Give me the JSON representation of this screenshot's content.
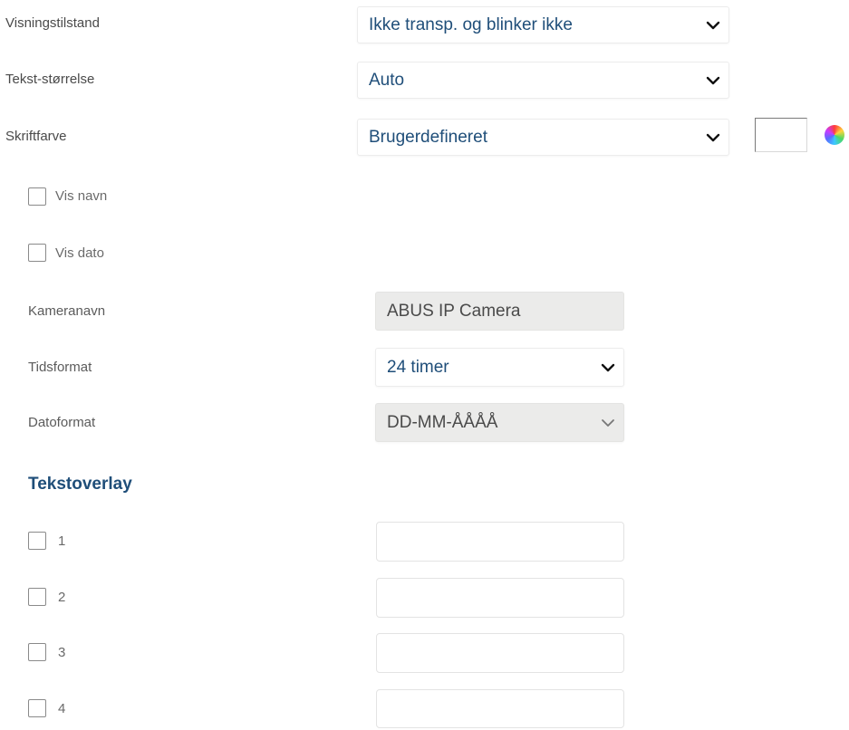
{
  "display_mode": {
    "label": "Visningstilstand",
    "value": "Ikke transp. og blinker ikke"
  },
  "text_size": {
    "label": "Tekst-størrelse",
    "value": "Auto"
  },
  "font_color": {
    "label": "Skriftfarve",
    "value": "Brugerdefineret",
    "swatch_color": "#ffffff"
  },
  "show_name": {
    "label": "Vis navn",
    "checked": false
  },
  "show_date": {
    "label": "Vis dato",
    "checked": false
  },
  "camera_name": {
    "label": "Kameranavn",
    "value": "ABUS IP Camera"
  },
  "time_format": {
    "label": "Tidsformat",
    "value": "24 timer"
  },
  "date_format": {
    "label": "Datoformat",
    "value": "DD-MM-ÅÅÅÅ"
  },
  "text_overlay": {
    "heading": "Tekstoverlay",
    "items": [
      {
        "label": "1",
        "checked": false,
        "value": ""
      },
      {
        "label": "2",
        "checked": false,
        "value": ""
      },
      {
        "label": "3",
        "checked": false,
        "value": ""
      },
      {
        "label": "4",
        "checked": false,
        "value": ""
      }
    ]
  },
  "colors": {
    "accent": "#1f4e79",
    "disabled_bg": "#ebebea"
  }
}
